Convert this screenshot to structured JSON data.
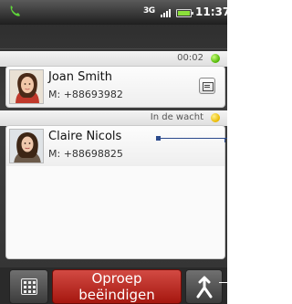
{
  "status_bar": {
    "network": "3G",
    "time": "11:37"
  },
  "calls": [
    {
      "duration": "00:02",
      "status_color": "#4db400",
      "name": "Joan Smith",
      "number": "M: +88693982"
    },
    {
      "status": "In de wacht",
      "status_color": "#e8b800",
      "name": "Claire Nicols",
      "number": "M: +88698825"
    }
  ],
  "bottom_bar": {
    "end_call_label": "Oproep beëindigen",
    "dialpad_icon": "dialpad-icon",
    "merge_icon": "merge-calls-icon"
  },
  "colors": {
    "end_call": "#b82a22",
    "active_dot": "#4db400",
    "hold_dot": "#e8b800"
  }
}
